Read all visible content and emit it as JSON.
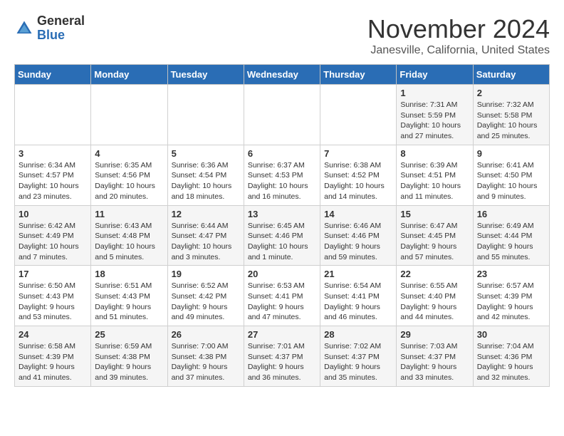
{
  "logo": {
    "general": "General",
    "blue": "Blue"
  },
  "header": {
    "month": "November 2024",
    "location": "Janesville, California, United States"
  },
  "days_of_week": [
    "Sunday",
    "Monday",
    "Tuesday",
    "Wednesday",
    "Thursday",
    "Friday",
    "Saturday"
  ],
  "weeks": [
    [
      {
        "day": "",
        "info": ""
      },
      {
        "day": "",
        "info": ""
      },
      {
        "day": "",
        "info": ""
      },
      {
        "day": "",
        "info": ""
      },
      {
        "day": "",
        "info": ""
      },
      {
        "day": "1",
        "info": "Sunrise: 7:31 AM\nSunset: 5:59 PM\nDaylight: 10 hours and 27 minutes."
      },
      {
        "day": "2",
        "info": "Sunrise: 7:32 AM\nSunset: 5:58 PM\nDaylight: 10 hours and 25 minutes."
      }
    ],
    [
      {
        "day": "3",
        "info": "Sunrise: 6:34 AM\nSunset: 4:57 PM\nDaylight: 10 hours and 23 minutes."
      },
      {
        "day": "4",
        "info": "Sunrise: 6:35 AM\nSunset: 4:56 PM\nDaylight: 10 hours and 20 minutes."
      },
      {
        "day": "5",
        "info": "Sunrise: 6:36 AM\nSunset: 4:54 PM\nDaylight: 10 hours and 18 minutes."
      },
      {
        "day": "6",
        "info": "Sunrise: 6:37 AM\nSunset: 4:53 PM\nDaylight: 10 hours and 16 minutes."
      },
      {
        "day": "7",
        "info": "Sunrise: 6:38 AM\nSunset: 4:52 PM\nDaylight: 10 hours and 14 minutes."
      },
      {
        "day": "8",
        "info": "Sunrise: 6:39 AM\nSunset: 4:51 PM\nDaylight: 10 hours and 11 minutes."
      },
      {
        "day": "9",
        "info": "Sunrise: 6:41 AM\nSunset: 4:50 PM\nDaylight: 10 hours and 9 minutes."
      }
    ],
    [
      {
        "day": "10",
        "info": "Sunrise: 6:42 AM\nSunset: 4:49 PM\nDaylight: 10 hours and 7 minutes."
      },
      {
        "day": "11",
        "info": "Sunrise: 6:43 AM\nSunset: 4:48 PM\nDaylight: 10 hours and 5 minutes."
      },
      {
        "day": "12",
        "info": "Sunrise: 6:44 AM\nSunset: 4:47 PM\nDaylight: 10 hours and 3 minutes."
      },
      {
        "day": "13",
        "info": "Sunrise: 6:45 AM\nSunset: 4:46 PM\nDaylight: 10 hours and 1 minute."
      },
      {
        "day": "14",
        "info": "Sunrise: 6:46 AM\nSunset: 4:46 PM\nDaylight: 9 hours and 59 minutes."
      },
      {
        "day": "15",
        "info": "Sunrise: 6:47 AM\nSunset: 4:45 PM\nDaylight: 9 hours and 57 minutes."
      },
      {
        "day": "16",
        "info": "Sunrise: 6:49 AM\nSunset: 4:44 PM\nDaylight: 9 hours and 55 minutes."
      }
    ],
    [
      {
        "day": "17",
        "info": "Sunrise: 6:50 AM\nSunset: 4:43 PM\nDaylight: 9 hours and 53 minutes."
      },
      {
        "day": "18",
        "info": "Sunrise: 6:51 AM\nSunset: 4:43 PM\nDaylight: 9 hours and 51 minutes."
      },
      {
        "day": "19",
        "info": "Sunrise: 6:52 AM\nSunset: 4:42 PM\nDaylight: 9 hours and 49 minutes."
      },
      {
        "day": "20",
        "info": "Sunrise: 6:53 AM\nSunset: 4:41 PM\nDaylight: 9 hours and 47 minutes."
      },
      {
        "day": "21",
        "info": "Sunrise: 6:54 AM\nSunset: 4:41 PM\nDaylight: 9 hours and 46 minutes."
      },
      {
        "day": "22",
        "info": "Sunrise: 6:55 AM\nSunset: 4:40 PM\nDaylight: 9 hours and 44 minutes."
      },
      {
        "day": "23",
        "info": "Sunrise: 6:57 AM\nSunset: 4:39 PM\nDaylight: 9 hours and 42 minutes."
      }
    ],
    [
      {
        "day": "24",
        "info": "Sunrise: 6:58 AM\nSunset: 4:39 PM\nDaylight: 9 hours and 41 minutes."
      },
      {
        "day": "25",
        "info": "Sunrise: 6:59 AM\nSunset: 4:38 PM\nDaylight: 9 hours and 39 minutes."
      },
      {
        "day": "26",
        "info": "Sunrise: 7:00 AM\nSunset: 4:38 PM\nDaylight: 9 hours and 37 minutes."
      },
      {
        "day": "27",
        "info": "Sunrise: 7:01 AM\nSunset: 4:37 PM\nDaylight: 9 hours and 36 minutes."
      },
      {
        "day": "28",
        "info": "Sunrise: 7:02 AM\nSunset: 4:37 PM\nDaylight: 9 hours and 35 minutes."
      },
      {
        "day": "29",
        "info": "Sunrise: 7:03 AM\nSunset: 4:37 PM\nDaylight: 9 hours and 33 minutes."
      },
      {
        "day": "30",
        "info": "Sunrise: 7:04 AM\nSunset: 4:36 PM\nDaylight: 9 hours and 32 minutes."
      }
    ]
  ]
}
